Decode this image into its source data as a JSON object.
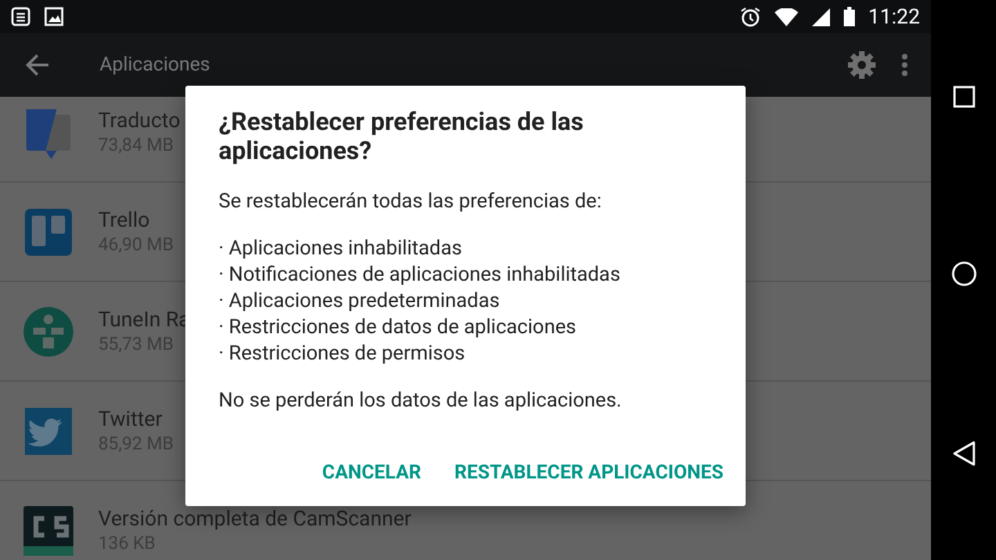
{
  "status_bar": {
    "time": "11:22"
  },
  "toolbar": {
    "title": "Aplicaciones"
  },
  "apps": [
    {
      "name": "Traducto",
      "size": "73,84 MB"
    },
    {
      "name": "Trello",
      "size": "46,90 MB"
    },
    {
      "name": "TuneIn Ra",
      "size": "55,73 MB"
    },
    {
      "name": "Twitter",
      "size": "85,92 MB"
    },
    {
      "name": "Versión completa de CamScanner",
      "size": "136 KB"
    }
  ],
  "dialog": {
    "title": "¿Restablecer preferencias de las aplicaciones?",
    "intro": "Se restablecerán todas las preferencias de:",
    "items": [
      "· Aplicaciones inhabilitadas",
      "· Notificaciones de aplicaciones inhabilitadas",
      "· Aplicaciones predeterminadas",
      "· Restricciones de datos de aplicaciones",
      "· Restricciones de permisos"
    ],
    "note": "No se perderán los datos de las aplicaciones.",
    "buttons": [
      "CANCELAR",
      "RESTABLECER APLICACIONES"
    ]
  }
}
